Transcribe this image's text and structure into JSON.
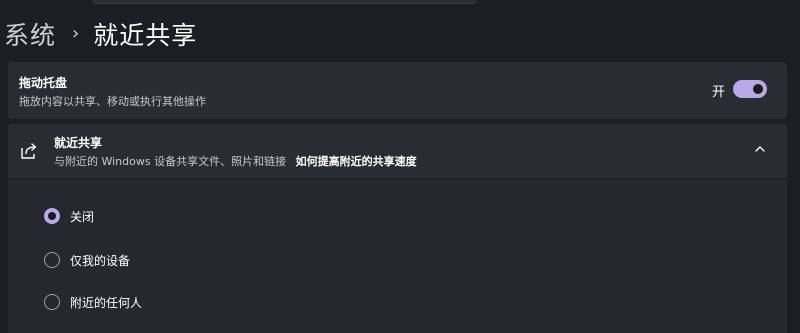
{
  "breadcrumb": {
    "parent": "系统",
    "separator": "›",
    "current": "就近共享"
  },
  "drag_tray": {
    "title": "拖动托盘",
    "description": "拖放内容以共享、移动或执行其他操作",
    "toggle_label": "开",
    "toggle_on": true
  },
  "nearby_sharing": {
    "icon": "share-icon",
    "title": "就近共享",
    "description": "与附近的 Windows 设备共享文件、照片和链接",
    "help_link": "如何提高附近的共享速度",
    "expanded": true,
    "options": [
      {
        "label": "关闭",
        "selected": true
      },
      {
        "label": "仅我的设备",
        "selected": false
      },
      {
        "label": "附近的任何人",
        "selected": false
      }
    ]
  },
  "colors": {
    "background": "#1c1e26",
    "card": "#2a2c34",
    "accent": "#b7a9e6"
  }
}
